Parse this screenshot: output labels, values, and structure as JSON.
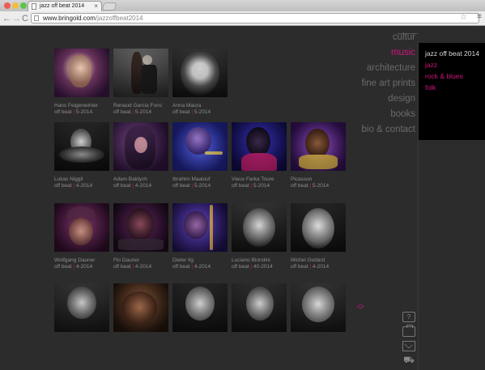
{
  "browser": {
    "tab_title": "jazz off beat 2014",
    "tab_close": "×",
    "url_domain": "www.bringold.com",
    "url_path": "/jazzoffbeat2014",
    "back": "←",
    "forward": "→",
    "reload": "C",
    "star": "☆",
    "menu": "≡"
  },
  "nav": {
    "items": [
      {
        "label": "cultur",
        "active": false
      },
      {
        "label": "music",
        "active": true
      },
      {
        "label": "architecture",
        "active": false
      },
      {
        "label": "fine art prints",
        "active": false
      },
      {
        "label": "design",
        "active": false
      },
      {
        "label": "books",
        "active": false
      },
      {
        "label": "bio & contact",
        "active": false
      }
    ]
  },
  "submenu": {
    "title": "jazz off beat 2014",
    "items": [
      "jazz",
      "rock & blues",
      "folk"
    ]
  },
  "gallery": {
    "rows": [
      [
        {
          "name": "Hans Feigenwinter",
          "event": "off beat",
          "date": "5-2014"
        },
        {
          "name": "Renaud Garcia Fons",
          "event": "off beat",
          "date": "5-2014"
        },
        {
          "name": "Anna Maura",
          "event": "off beat",
          "date": "5-2014"
        }
      ],
      [
        {
          "name": "Lukas Niggli",
          "event": "off beat",
          "date": "4-2014"
        },
        {
          "name": "Adam Baldych",
          "event": "off beat",
          "date": "4-2014"
        },
        {
          "name": "Ibrahim Maalouf",
          "event": "off beat",
          "date": "5-2014"
        },
        {
          "name": "Vieux Farka Toure",
          "event": "off beat",
          "date": "5-2014"
        },
        {
          "name": "Picasson",
          "event": "off beat",
          "date": "5-2014"
        }
      ],
      [
        {
          "name": "Wolfgang Dauner",
          "event": "off beat",
          "date": "4-2014"
        },
        {
          "name": "Flo Dauner",
          "event": "off beat",
          "date": "4-2014"
        },
        {
          "name": "Dieter Ilg",
          "event": "off beat",
          "date": "4-2014"
        },
        {
          "name": "Luciano Biondini",
          "event": "off beat",
          "date": "40-2014"
        },
        {
          "name": "Michel Godard",
          "event": "off beat",
          "date": "4-2014"
        }
      ],
      [
        {
          "name": "",
          "event": "",
          "date": ""
        },
        {
          "name": "",
          "event": "",
          "date": ""
        },
        {
          "name": "",
          "event": "",
          "date": ""
        },
        {
          "name": "",
          "event": "",
          "date": ""
        },
        {
          "name": "",
          "event": "",
          "date": ""
        }
      ]
    ]
  },
  "scroll": {
    "up": "︿",
    "down": "﹀"
  },
  "footer_icons": [
    {
      "name": "help-icon",
      "glyph": "?"
    },
    {
      "name": "briefcase-icon",
      "glyph": ""
    },
    {
      "name": "mail-icon",
      "glyph": ""
    },
    {
      "name": "cart-icon",
      "glyph": "⛟"
    }
  ],
  "colors": {
    "accent": "#d1137d",
    "background": "#2c2c2c",
    "nav_text": "#6a6a6a"
  }
}
